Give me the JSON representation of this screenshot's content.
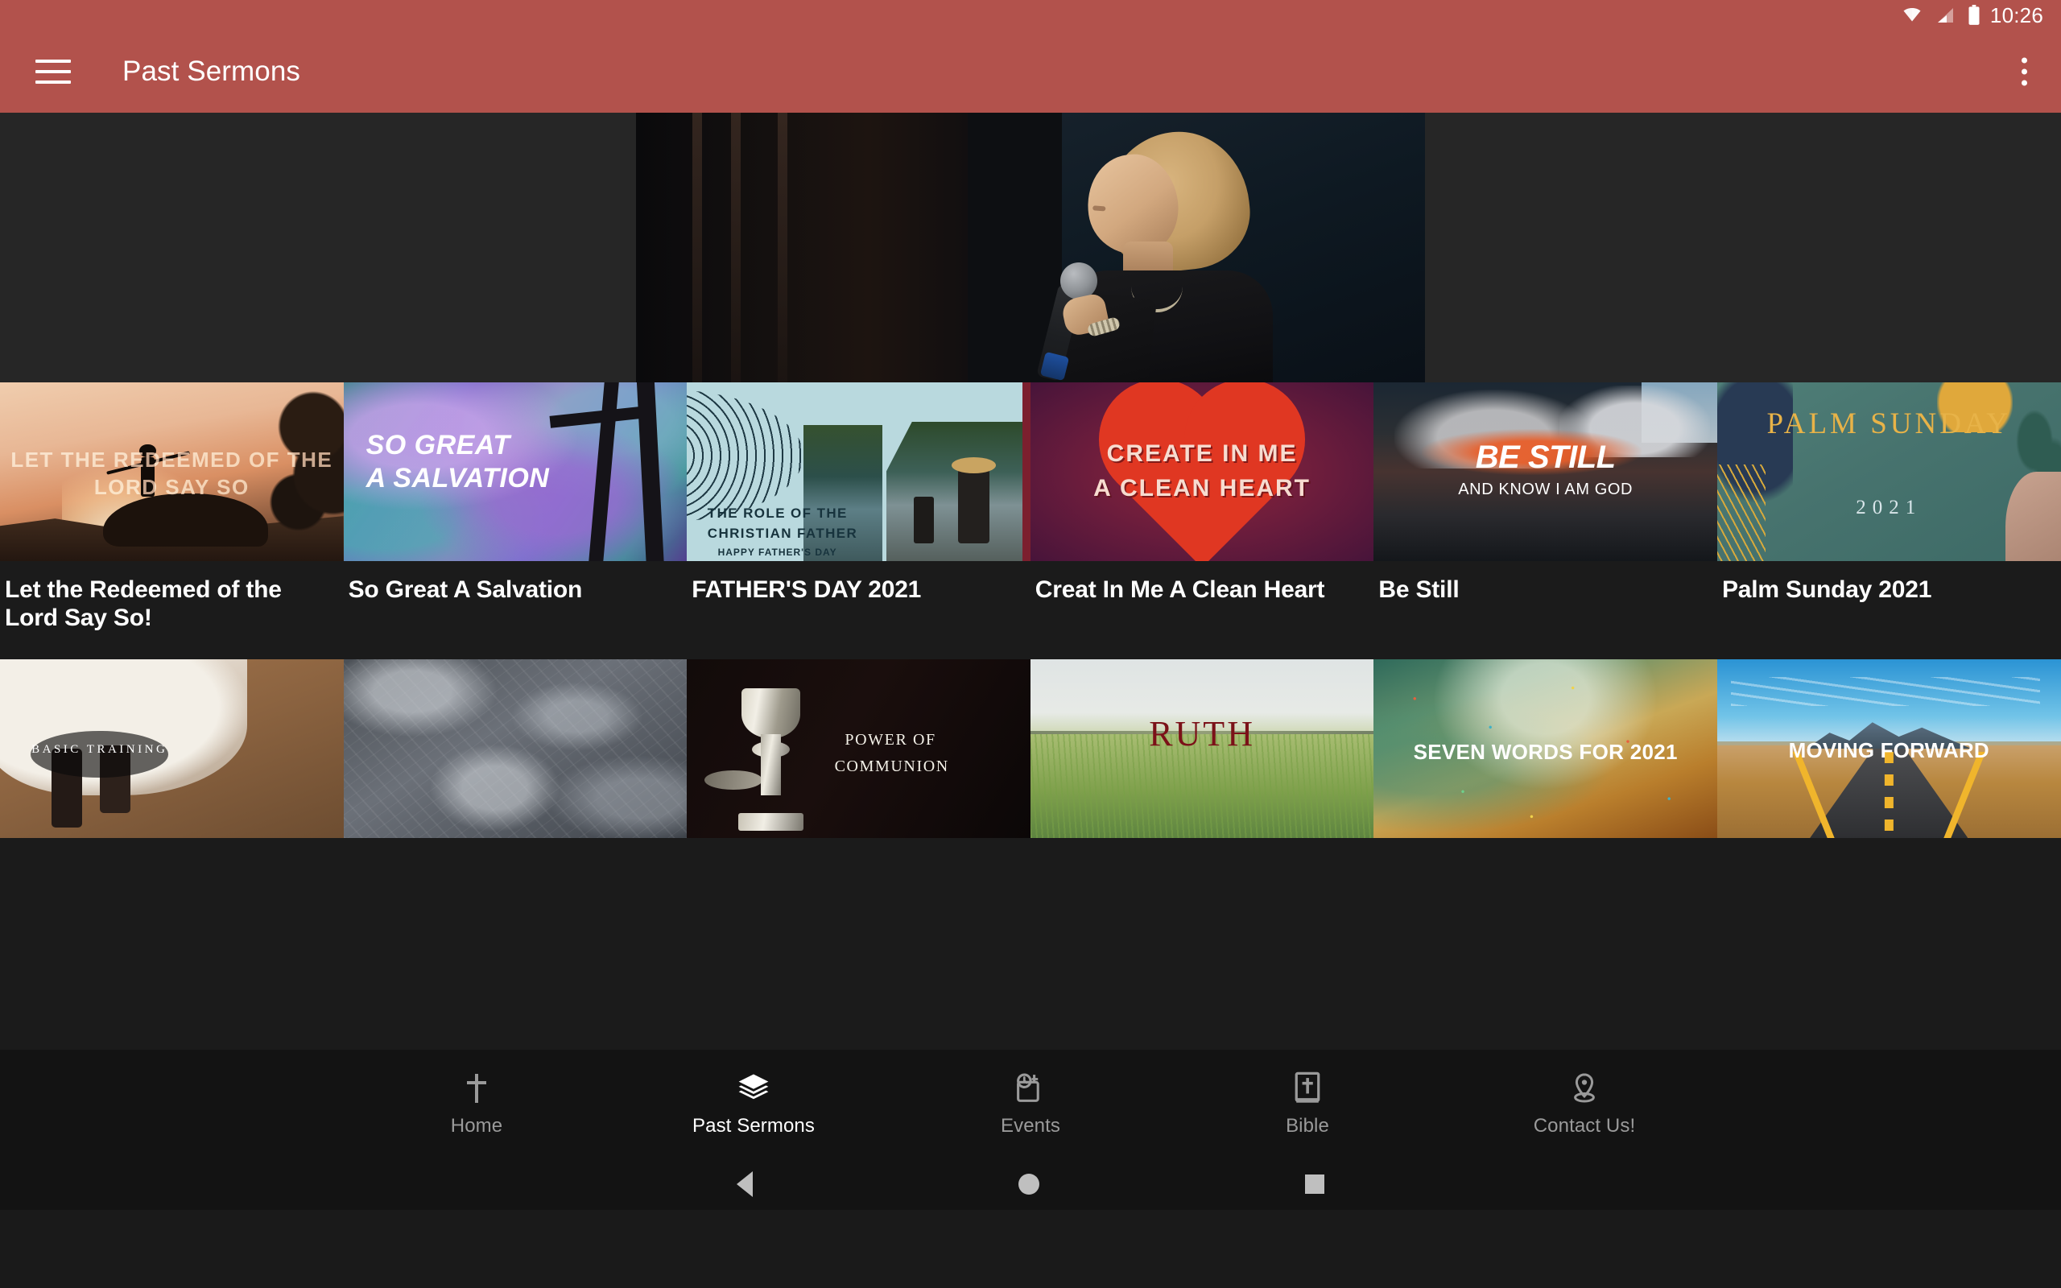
{
  "status_bar": {
    "time": "10:26",
    "icons": [
      "wifi-icon",
      "cell-signal-icon",
      "battery-icon"
    ]
  },
  "app_bar": {
    "menu_icon": "hamburger-menu-icon",
    "title": "Past Sermons",
    "overflow_icon": "overflow-menu-icon",
    "background_color": "#b2524c"
  },
  "hero": {
    "alt": "woman speaking into a handheld microphone on a dark stage"
  },
  "sermons_row1": [
    {
      "title": "Let the Redeemed of the Lord Say So!",
      "thumb_text": "LET THE REDEEMED OF THE LORD SAY SO",
      "thumb_style": "sunset-silhouette"
    },
    {
      "title": "So Great A Salvation",
      "thumb_line1": "SO GREAT",
      "thumb_line2": "A SALVATION",
      "thumb_style": "purple-smoke-crosses"
    },
    {
      "title": "FATHER'S DAY 2021",
      "thumb_line1": "THE ROLE OF THE",
      "thumb_line2": "CHRISTIAN FATHER",
      "thumb_line3": "HAPPY FATHER'S DAY",
      "thumb_style": "light-blue-father-child"
    },
    {
      "title": "Creat In Me A Clean Heart",
      "thumb_line1": "CREATE IN ME",
      "thumb_line2": "A CLEAN HEART",
      "thumb_style": "maroon-red-heart"
    },
    {
      "title": "Be Still",
      "thumb_line1": "BE STILL",
      "thumb_line2": "AND KNOW I AM GOD",
      "thumb_style": "storm-clouds"
    },
    {
      "title": "Palm Sunday 2021",
      "thumb_line1": "PALM SUNDAY",
      "thumb_line2": "2021",
      "thumb_style": "teal-gold-palm"
    }
  ],
  "sermons_row2": [
    {
      "thumb_text": "BASIC TRAINING",
      "thumb_style": "boots-dress-dirt"
    },
    {
      "thumb_text": "",
      "thumb_style": "grey-stone-texture"
    },
    {
      "thumb_line1": "POWER OF",
      "thumb_line2": "COMMUNION",
      "thumb_style": "silver-chalice-black"
    },
    {
      "thumb_text": "RUTH",
      "thumb_style": "wheat-field"
    },
    {
      "thumb_text": "SEVEN WORDS FOR 2021",
      "thumb_style": "teal-gold-abstract"
    },
    {
      "thumb_text": "MOVING FORWARD",
      "thumb_style": "desert-highway"
    }
  ],
  "bottom_nav": {
    "items": [
      {
        "label": "Home",
        "icon": "cross-icon",
        "active": false
      },
      {
        "label": "Past Sermons",
        "icon": "layers-icon",
        "active": true
      },
      {
        "label": "Events",
        "icon": "event-clock-icon",
        "active": false
      },
      {
        "label": "Bible",
        "icon": "bible-book-icon",
        "active": false
      },
      {
        "label": "Contact Us!",
        "icon": "location-pin-icon",
        "active": false
      }
    ]
  },
  "android_nav": {
    "back_icon": "back-triangle-icon",
    "home_icon": "home-circle-icon",
    "recents_icon": "recents-square-icon"
  },
  "colors": {
    "accent": "#b2524c",
    "background": "#1b1b1b",
    "nav_background": "#131313",
    "text_primary": "#ffffff",
    "text_muted": "#9a9a9a"
  }
}
